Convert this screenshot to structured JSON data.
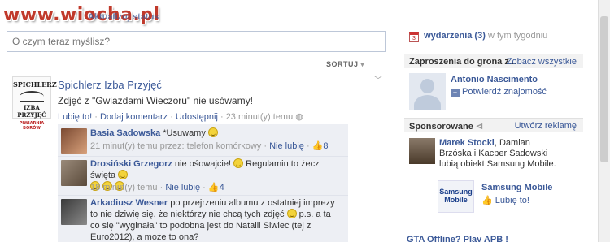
{
  "watermark": "www.wiocha.pl",
  "status_tabs": "Aktualizuj status",
  "status": {
    "placeholder": "O czym teraz myślisz?"
  },
  "sort": {
    "label": "SORTUJ"
  },
  "post": {
    "logo_lines": [
      "SPICHLERZ",
      "IZBA PRZYJĘĆ",
      "PIWIARNIA BORÓW"
    ],
    "author": "Spichlerz Izba Przyjęć",
    "text": "Zdjęć z \"Gwiazdami Wieczoru\" nie usówamy!",
    "like": "Lubię to!",
    "comment": "Dodaj komentarz",
    "share": "Udostępnij",
    "time": "23 minut(y) temu"
  },
  "comments": [
    {
      "name": "Basia Sadowska",
      "text": "*Usuwamy",
      "time": "21 minut(y) temu przez: telefon komórkowy",
      "unlike": "Nie lubię",
      "likes": "8"
    },
    {
      "name": "Drosiński Grzegorz",
      "text": "nie ośowajcie!",
      "text2": "Regulamin to żecz święta",
      "time": "18 minut(y) temu",
      "unlike": "Nie lubię",
      "likes": "4"
    },
    {
      "name": "Arkadiusz Wesner",
      "text": "po przejrzeniu albumu z ostatniej imprezy to nie dziwię się, że niektórzy nie chcą tych zdjęć",
      "text2": "p.s. a ta co się \"wyginała\" to podobna jest do Natalii Siwiec (tej z Euro2012), a może to ona?"
    }
  ],
  "events": {
    "icon": "calendar-icon",
    "day": "3",
    "label": "wydarzenia (3)",
    "rest": "w tym tygodniu"
  },
  "friend_requests": {
    "title": "Zaproszenia do grona z...",
    "link": "Zobacz wszystkie",
    "name": "Antonio Nascimento",
    "confirm": "Potwierdź znajomość"
  },
  "sponsored": {
    "title": "Sponsorowane",
    "link": "Utwórz reklamę",
    "friends_text": "Marek Stocki, Damian Brzóska i Kacper Sadowski lubią obiekt Samsung Mobile.",
    "friend_bold": "Marek Stocki",
    "friends_rest": ", Damian Brzóska i Kacper Sadowski lubią obiekt Samsung Mobile.",
    "brand_logo": "Samsung Mobile",
    "brand": "Samsung Mobile",
    "like": "Lubię to!",
    "next": "GTA Offline? Play APB !"
  }
}
